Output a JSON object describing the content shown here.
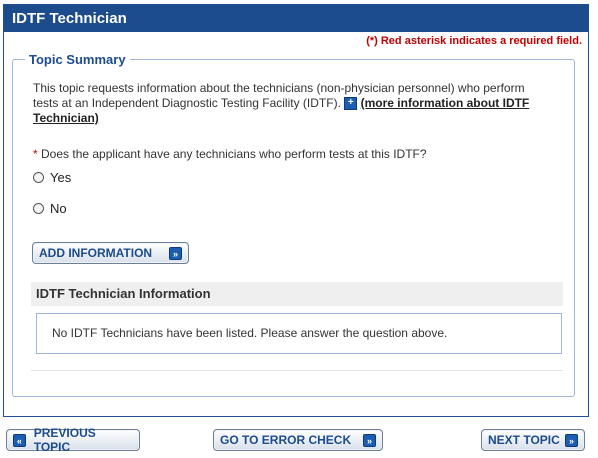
{
  "panel": {
    "title": "IDTF Technician",
    "required_note": "(*) Red asterisk indicates a required field."
  },
  "topic": {
    "legend": "Topic Summary",
    "intro_text": "This topic requests information about the technicians (non-physician personnel) who perform tests at an Independent Diagnostic Testing Facility (IDTF).",
    "more_info_link": "(more information about IDTF Technician)",
    "question_asterisk": "*",
    "question": "Does the applicant have any technicians who perform tests at this IDTF?",
    "options": [
      "Yes",
      "No"
    ],
    "add_button": "ADD INFORMATION"
  },
  "technician_info": {
    "header": "IDTF Technician Information",
    "empty_message": "No IDTF Technicians have been listed. Please answer the question above."
  },
  "nav": {
    "previous": "PREVIOUS TOPIC",
    "error_check": "GO TO ERROR CHECK",
    "next": "NEXT TOPIC"
  },
  "colors": {
    "header_bg": "#1c4c8c",
    "required_red": "#c00000",
    "icon_blue": "#1c5db2"
  }
}
